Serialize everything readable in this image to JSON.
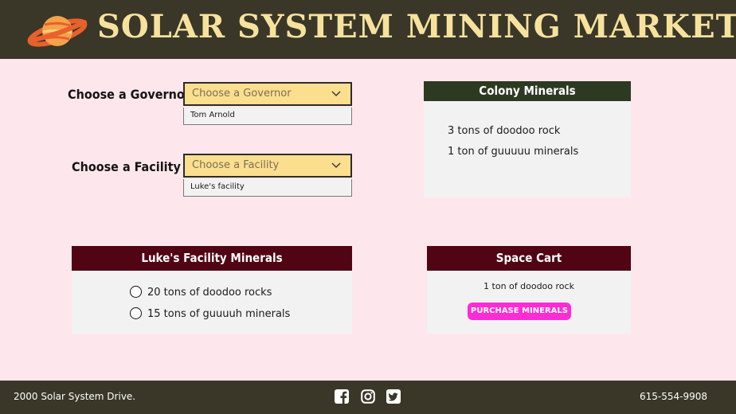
{
  "header": {
    "title": "SOLAR SYSTEM MINING MARKET",
    "logo_icon": "ringed-planet-icon"
  },
  "governor_select": {
    "label": "Choose a Governor",
    "placeholder": "Choose a Governor",
    "options": [
      "Tom Arnold"
    ]
  },
  "facility_select": {
    "label": "Choose a Facility",
    "placeholder": "Choose a Facility",
    "options": [
      "Luke's facility"
    ]
  },
  "colony_panel": {
    "title": "Colony Minerals",
    "items": [
      "3 tons of doodoo rock",
      "1 ton of guuuuu minerals"
    ]
  },
  "facility_panel": {
    "title": "Luke's Facility Minerals",
    "items": [
      "20 tons of doodoo rocks",
      "15 tons of guuuuh minerals"
    ]
  },
  "cart_panel": {
    "title": "Space Cart",
    "items": [
      "1 ton of doodoo rock"
    ],
    "purchase_label": "PURCHASE MINERALS"
  },
  "footer": {
    "address": "2000 Solar System Drive.",
    "phone": "615-554-9908",
    "social_icons": [
      "facebook-icon",
      "instagram-icon",
      "twitter-icon"
    ]
  },
  "colors": {
    "header_bg": "#3a3729",
    "title_text": "#f7e29d",
    "page_bg": "#fde7ec",
    "select_bg": "#fbdf8f",
    "colony_header": "#2d3a22",
    "panel_header": "#500414",
    "purchase_button": "#ff2bd5"
  }
}
